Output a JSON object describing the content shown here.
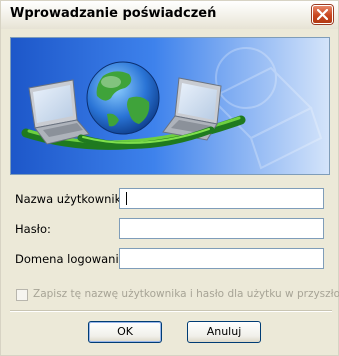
{
  "window": {
    "title": "Wprowadzanie poświadczeń"
  },
  "banner": {
    "accent_colors": [
      "#1c5dc3",
      "#2b8f2f",
      "#62a0ff"
    ],
    "icons": [
      "globe-icon",
      "laptop-icon",
      "laptop-icon"
    ]
  },
  "form": {
    "username": {
      "label": "Nazwa użytkownika:",
      "value": ""
    },
    "password": {
      "label": "Hasło:",
      "value": ""
    },
    "domain": {
      "label": "Domena logowania:",
      "value": ""
    },
    "remember": {
      "label": "Zapisz tę nazwę użytkownika i hasło dla użytku w przyszłości",
      "checked": false,
      "enabled": false
    }
  },
  "buttons": {
    "ok": "OK",
    "cancel": "Anuluj"
  }
}
